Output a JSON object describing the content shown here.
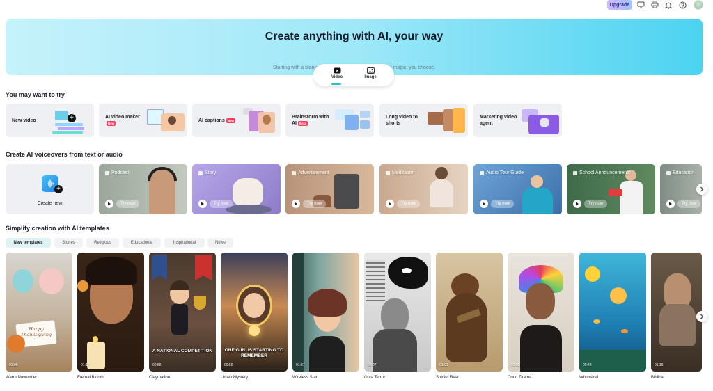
{
  "topbar": {
    "upgrade_label": "Upgrade",
    "icons": [
      "monitor-icon",
      "print-icon",
      "bell-icon",
      "help-icon",
      "avatar"
    ]
  },
  "hero": {
    "title": "Create anything with AI, your way",
    "subtitle": "Starting with a blank slate, ready templates, or some AI magic, you choose.",
    "tabs": [
      {
        "label": "Video",
        "icon": "play-icon",
        "active": true
      },
      {
        "label": "Image",
        "icon": "image-icon",
        "active": false
      }
    ]
  },
  "try_section": {
    "title": "You may want to try",
    "cards": [
      {
        "label": "New video",
        "badge": ""
      },
      {
        "label": "AI video maker",
        "badge": "New"
      },
      {
        "label": "AI captions",
        "badge": "New"
      },
      {
        "label": "Brainstorm with AI",
        "badge": "Beta"
      },
      {
        "label": "Long video to shorts",
        "badge": ""
      },
      {
        "label": "Marketing video agent",
        "badge": ""
      }
    ]
  },
  "voiceover_section": {
    "title": "Create AI voiceovers from text or audio",
    "create_label": "Create new",
    "try_label": "Try now",
    "cards": [
      {
        "label": "Podcast"
      },
      {
        "label": "Story"
      },
      {
        "label": "Advertisement"
      },
      {
        "label": "Meditation"
      },
      {
        "label": "Audio Tour Guide"
      },
      {
        "label": "School Announcements"
      },
      {
        "label": "Education"
      }
    ]
  },
  "templates_section": {
    "title": "Simplify creation with AI templates",
    "tabs": [
      "New templates",
      "Stories",
      "Religious",
      "Educational",
      "Inspirational",
      "News"
    ],
    "active_tab": "New templates",
    "cards": [
      {
        "name": "Warm November",
        "duration": "01:06",
        "overlay": "Happy Thanksgiving"
      },
      {
        "name": "Eternal Bloom",
        "duration": "01:17",
        "overlay": ""
      },
      {
        "name": "Claymation",
        "duration": "00:56",
        "overlay": "A NATIONAL COMPETITION"
      },
      {
        "name": "Urban Mystery",
        "duration": "00:59",
        "overlay": "ONE GIRL IS STARTING TO REMEMBER"
      },
      {
        "name": "Wireless Star",
        "duration": "01:37",
        "overlay": ""
      },
      {
        "name": "Orca Terror",
        "duration": "02:27",
        "overlay": ""
      },
      {
        "name": "Soldier Bear",
        "duration": "01:01",
        "overlay": ""
      },
      {
        "name": "Court Drama",
        "duration": "01:00",
        "overlay": ""
      },
      {
        "name": "Whimsical",
        "duration": "00:48",
        "overlay": ""
      },
      {
        "name": "Biblical",
        "duration": "01:16",
        "overlay": ""
      }
    ]
  },
  "colors": {
    "accent": "#1fc3cc",
    "new_badge": "#ff3b5c",
    "card_bg": "#eef0f3"
  }
}
